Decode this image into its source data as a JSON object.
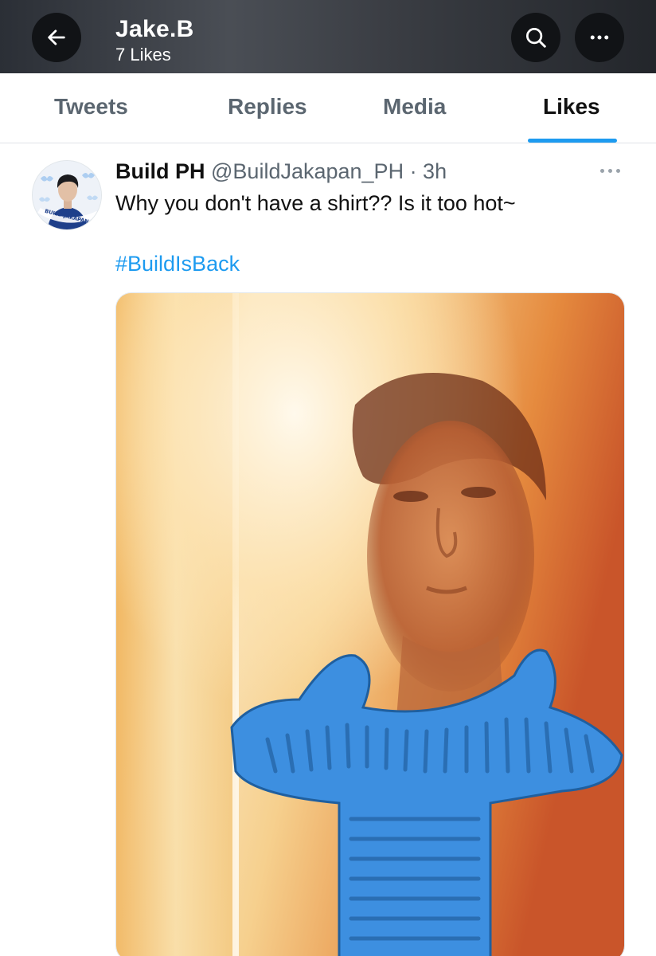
{
  "header": {
    "title": "Jake.B",
    "subtitle": "7 Likes",
    "back_icon": "arrow-left-icon",
    "search_icon": "search-icon",
    "more_icon": "more-horizontal-icon"
  },
  "tabs": [
    {
      "label": "Tweets",
      "active": false
    },
    {
      "label": "Replies",
      "active": false
    },
    {
      "label": "Media",
      "active": false
    },
    {
      "label": "Likes",
      "active": true
    }
  ],
  "tweet": {
    "display_name": "Build PH",
    "handle_time": "@BuildJakapan_PH · 3h",
    "text": "Why you don't have a shirt?? Is it too hot~",
    "hashtag": "#BuildIsBack",
    "avatar_caption": "BUILD JAKAPAN PH",
    "more_icon": "more-horizontal-icon"
  },
  "colors": {
    "accent": "#1d9bf0",
    "header_bg": "#2b2f36",
    "scarf": "#3d8fe0"
  }
}
